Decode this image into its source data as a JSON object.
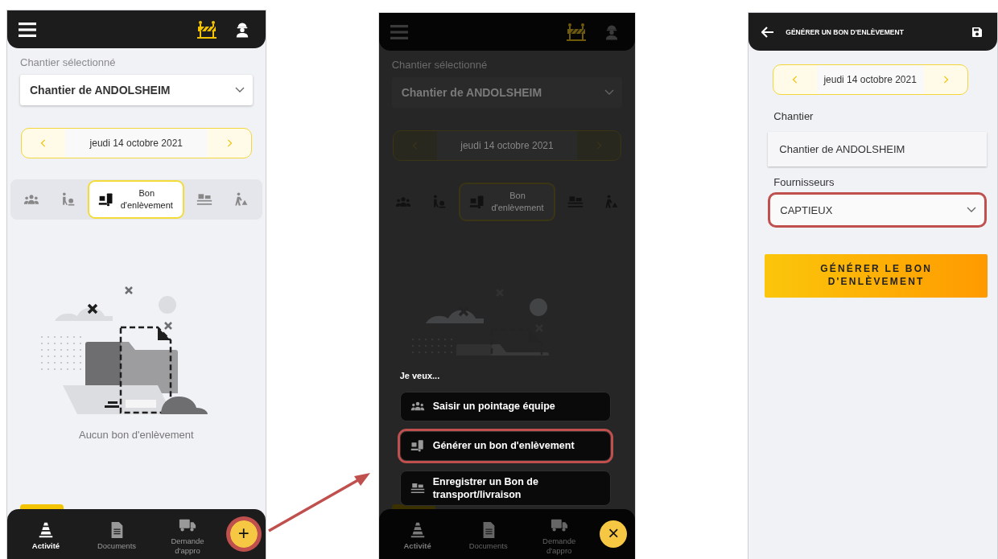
{
  "screens": [
    {
      "kind": "home",
      "dimmed": false,
      "site_label": "Chantier sélectionné",
      "site": "Chantier de ANDOLSHEIM",
      "date": "jeudi 14 octobre 2021",
      "tabs": [
        {
          "kind": "team",
          "selected": false
        },
        {
          "kind": "worker",
          "selected": false
        },
        {
          "kind": "boxcart",
          "label": "Bon d'enlèvement",
          "selected": true
        },
        {
          "kind": "pallet",
          "selected": false
        },
        {
          "kind": "digger",
          "selected": false
        }
      ],
      "empty_text": "Aucun bon d'enlèvement",
      "nav": [
        {
          "kind": "cone",
          "label": "Activité",
          "selected": true
        },
        {
          "kind": "doc",
          "label": "Documents",
          "selected": false
        },
        {
          "kind": "truck",
          "label": "Demande d'appro",
          "selected": false
        }
      ],
      "fab": {
        "symbol": "+",
        "highlighted": true
      }
    },
    {
      "kind": "home",
      "dimmed": true,
      "site_label": "Chantier sélectionné",
      "site": "Chantier de ANDOLSHEIM",
      "date": "jeudi 14 octobre 2021",
      "tabs": [
        {
          "kind": "team",
          "selected": false
        },
        {
          "kind": "worker",
          "selected": false
        },
        {
          "kind": "boxcart",
          "label": "Bon d'enlèvement",
          "selected": true
        },
        {
          "kind": "pallet",
          "selected": false
        },
        {
          "kind": "digger",
          "selected": false
        }
      ],
      "menu": {
        "prompt": "Je veux...",
        "actions": [
          {
            "kind": "team",
            "label": "Saisir un pointage équipe",
            "highlighted": false
          },
          {
            "kind": "boxcart",
            "label": "Générer un bon d'enlèvement",
            "highlighted": true
          },
          {
            "kind": "pallet",
            "label": "Enregistrer un Bon de transport/livraison",
            "highlighted": false
          }
        ]
      },
      "nav": [
        {
          "kind": "cone",
          "label": "Activité",
          "selected": true
        },
        {
          "kind": "doc",
          "label": "Documents",
          "selected": false
        },
        {
          "kind": "truck",
          "label": "Demande d'appro",
          "selected": false
        }
      ],
      "fab": {
        "symbol": "×",
        "highlighted": false
      }
    },
    {
      "kind": "form",
      "title": "GÉNÉRER UN BON D'ENLÈVEMENT",
      "date": "jeudi 14 octobre 2021",
      "fields": [
        {
          "kind": "text",
          "label": "Chantier",
          "value": "Chantier de ANDOLSHEIM",
          "highlighted": false
        },
        {
          "kind": "select",
          "label": "Fournisseurs",
          "value": "CAPTIEUX",
          "highlighted": true
        }
      ],
      "submit": "GÉNÉRER LE BON D'ENLÈVEMENT"
    }
  ]
}
